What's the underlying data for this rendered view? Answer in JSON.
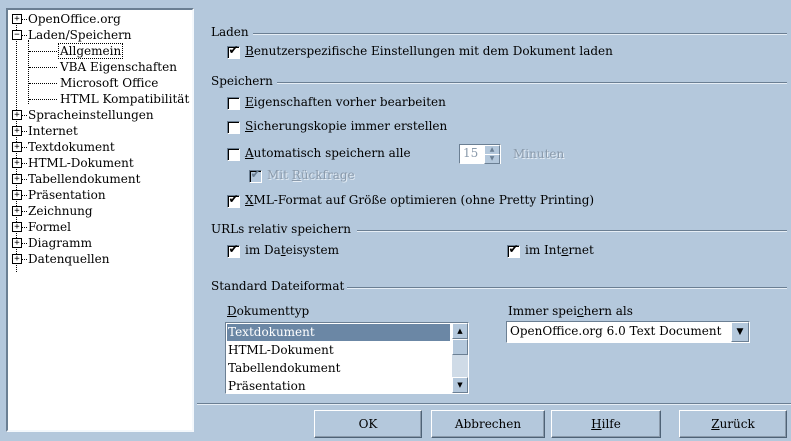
{
  "tree": {
    "items": [
      {
        "label": "OpenOffice.org",
        "expander": "+"
      },
      {
        "label": "Laden/Speichern",
        "expander": "−"
      },
      {
        "label": "Allgemein"
      },
      {
        "label": "VBA Eigenschaften"
      },
      {
        "label": "Microsoft Office"
      },
      {
        "label": "HTML Kompatibilität"
      },
      {
        "label": "Spracheinstellungen",
        "expander": "+"
      },
      {
        "label": "Internet",
        "expander": "+"
      },
      {
        "label": "Textdokument",
        "expander": "+"
      },
      {
        "label": "HTML-Dokument",
        "expander": "+"
      },
      {
        "label": "Tabellendokument",
        "expander": "+"
      },
      {
        "label": "Präsentation",
        "expander": "+"
      },
      {
        "label": "Zeichnung",
        "expander": "+"
      },
      {
        "label": "Formel",
        "expander": "+"
      },
      {
        "label": "Diagramm",
        "expander": "+"
      },
      {
        "label": "Datenquellen",
        "expander": "+"
      }
    ]
  },
  "laden": {
    "title": "Laden",
    "user_settings": {
      "pre": "",
      "u": "B",
      "post": "enutzerspezifische Einstellungen mit dem Dokument laden",
      "checked": true
    }
  },
  "speichern": {
    "title": "Speichern",
    "edit_props": {
      "pre": "",
      "u": "E",
      "post": "igenschaften vorher bearbeiten",
      "checked": false
    },
    "backup": {
      "pre": "",
      "u": "S",
      "post": "icherungskopie immer erstellen",
      "checked": false
    },
    "autosave": {
      "pre": "",
      "u": "A",
      "post": "utomatisch speichern alle",
      "checked": false
    },
    "autosave_value": "15",
    "autosave_unit": "Minuten",
    "confirm": {
      "pre": "Mit ",
      "u": "R",
      "post": "ückfrage",
      "checked": true
    },
    "xml_optimize": {
      "pre": "",
      "u": "X",
      "post": "ML-Format auf Größe optimieren (ohne Pretty Printing)",
      "checked": true
    }
  },
  "urls": {
    "title": "URLs relativ speichern",
    "filesystem": {
      "pre": "im Da",
      "u": "t",
      "post": "eisystem",
      "checked": true
    },
    "internet": {
      "pre": "im Int",
      "u": "e",
      "post": "rnet",
      "checked": true
    }
  },
  "format": {
    "title": "Standard Dateiformat",
    "doctype_label": {
      "pre": "",
      "u": "D",
      "post": "okumenttyp"
    },
    "saveas_label": {
      "pre": "Immer spei",
      "u": "c",
      "post": "hern als"
    },
    "doctypes": [
      "Textdokument",
      "HTML-Dokument",
      "Tabellendokument",
      "Präsentation"
    ],
    "saveas_value": "OpenOffice.org 6.0 Text Document"
  },
  "buttons": {
    "ok": "OK",
    "cancel": "Abbrechen",
    "help": {
      "pre": "",
      "u": "H",
      "post": "ilfe"
    },
    "back": {
      "pre": "",
      "u": "Z",
      "post": "urück"
    }
  }
}
